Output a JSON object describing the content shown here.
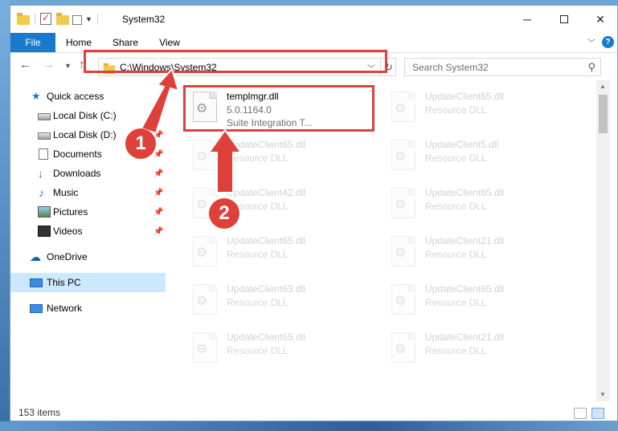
{
  "window": {
    "title": "System32"
  },
  "ribbon": {
    "tabs": [
      "File",
      "Home",
      "Share",
      "View"
    ]
  },
  "address_bar": {
    "path": "C:\\Windows\\System32"
  },
  "search": {
    "placeholder": "Search System32"
  },
  "sidebar": {
    "items": [
      {
        "label": "Quick access",
        "icon": "star-icon"
      },
      {
        "label": "Local Disk (C:)",
        "icon": "drive-icon"
      },
      {
        "label": "Local Disk (D:)",
        "icon": "drive-icon"
      },
      {
        "label": "Documents",
        "icon": "documents-icon"
      },
      {
        "label": "Downloads",
        "icon": "download-icon"
      },
      {
        "label": "Music",
        "icon": "music-icon"
      },
      {
        "label": "Pictures",
        "icon": "pictures-icon"
      },
      {
        "label": "Videos",
        "icon": "videos-icon"
      },
      {
        "label": "OneDrive",
        "icon": "cloud-icon"
      },
      {
        "label": "This PC",
        "icon": "computer-icon"
      },
      {
        "label": "Network",
        "icon": "network-icon"
      }
    ]
  },
  "files": [
    {
      "name": "templmgr.dll",
      "version": "5.0.1164.0",
      "description": "Suite Integration T..."
    },
    {
      "name": "UpdateClient65.dll",
      "description": "Resource DLL"
    },
    {
      "name": "UpdateClient65.dll",
      "description": "Resource DLL"
    },
    {
      "name": "UpdateClient5.dll",
      "description": "Resource DLL"
    },
    {
      "name": "UpdateClient42.dll",
      "description": "Resource DLL"
    },
    {
      "name": "UpdateClient65.dll",
      "description": "Resource DLL"
    },
    {
      "name": "UpdateClient65.dll",
      "description": "Resource DLL"
    },
    {
      "name": "UpdateClient21.dll",
      "description": "Resource DLL"
    },
    {
      "name": "UpdateClient63.dll",
      "description": "Resource DLL"
    },
    {
      "name": "UpdateClient65.dll",
      "description": "Resource DLL"
    },
    {
      "name": "UpdateClient65.dll",
      "description": "Resource DLL"
    },
    {
      "name": "UpdateClient21.dll",
      "description": "Resource DLL"
    }
  ],
  "status": {
    "item_count": "153 items"
  },
  "callouts": {
    "step1": "1",
    "step2": "2"
  },
  "colors": {
    "accent": "#1979ca",
    "highlight": "#e0403a",
    "selection": "#cce8ff"
  }
}
